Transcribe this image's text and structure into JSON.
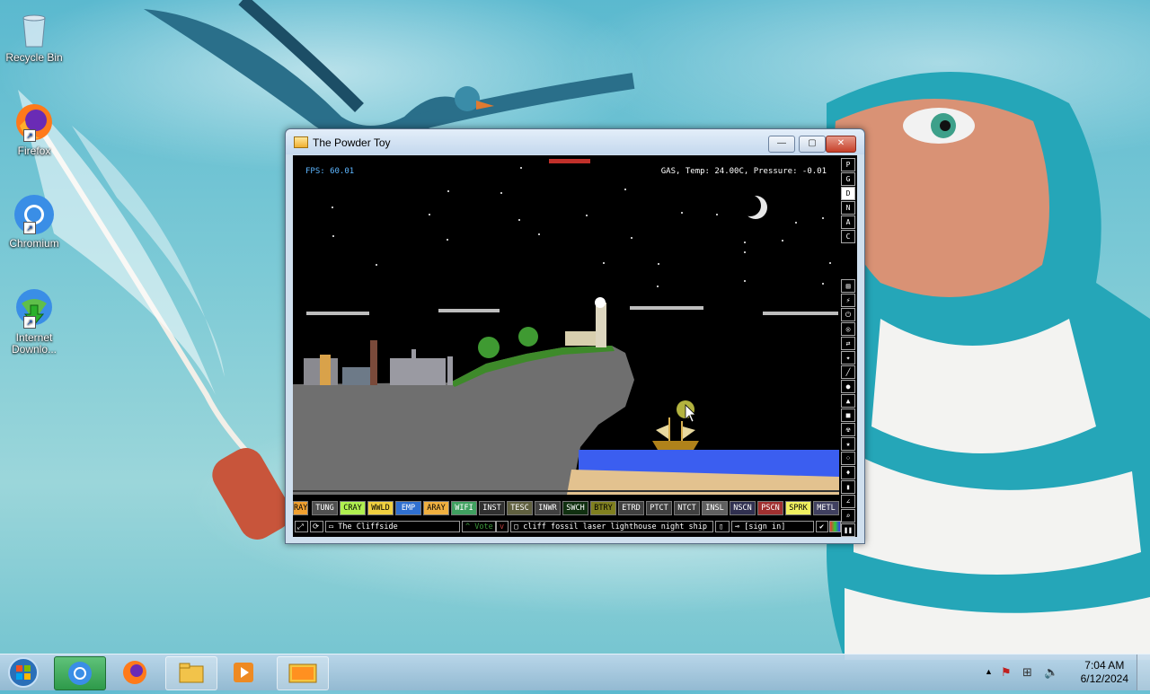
{
  "desktop": {
    "icons": [
      {
        "label": "Recycle Bin",
        "icon": "recycle-bin-icon"
      },
      {
        "label": "Firefox",
        "icon": "firefox-icon"
      },
      {
        "label": "Chromium",
        "icon": "chromium-icon"
      },
      {
        "label": "Internet Downlo...",
        "icon": "internet-download-manager-icon"
      }
    ]
  },
  "window": {
    "title": "The Powder Toy",
    "min_label": "—",
    "max_label": "▢",
    "close_label": "✕"
  },
  "game": {
    "fps": "FPS: 60.01",
    "hud": "GAS, Temp: 24.00C, Pressure: -0.01",
    "right_tools_top": [
      "P",
      "G",
      "D",
      "N",
      "A",
      "C"
    ],
    "selected_top_tool": "D",
    "elements": [
      "RAY",
      "TUNG",
      "CRAY",
      "WWLD",
      "EMP",
      "ARAY",
      "WIFI",
      "INST",
      "TESC",
      "INWR",
      "SWCH",
      "BTRY",
      "ETRD",
      "PTCT",
      "NTCT",
      "INSL",
      "NSCN",
      "PSCN",
      "SPRK",
      "METL"
    ],
    "save_name": "The Cliffside",
    "vote_label": "Vote",
    "tags": "cliff fossil laser lighthouse night ship",
    "sign_in": "[sign in]"
  },
  "colors": {
    "RAY": "#f0a030",
    "TUNG": "#505050",
    "CRAY": "#b0f050",
    "WWLD": "#f0d040",
    "EMP": "#3070d0",
    "ARAY": "#f0b040",
    "WIFI": "#40a060",
    "INST": "#303030",
    "TESC": "#606040",
    "INWR": "#404040",
    "SWCH": "#103010",
    "BTRY": "#808020",
    "ETRD": "#404040",
    "PTCT": "#404040",
    "NTCT": "#404040",
    "INSL": "#606060",
    "NSCN": "#303050",
    "PSCN": "#a03030",
    "SPRK": "#f0f060",
    "METL": "#404060"
  },
  "taskbar": {
    "apps": [
      "start-orb-icon",
      "chromium-icon",
      "firefox-icon",
      "file-explorer-icon",
      "media-player-icon",
      "powder-toy-icon"
    ],
    "time": "7:04 AM",
    "date": "6/12/2024"
  }
}
